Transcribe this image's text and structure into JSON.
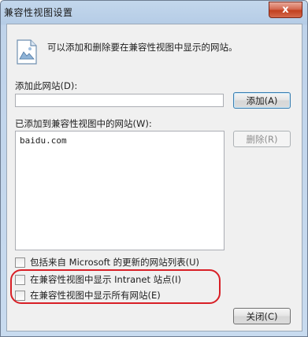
{
  "window": {
    "title": "兼容性视图设置",
    "close_glyph": "x"
  },
  "intro": {
    "text": "可以添加和删除要在兼容性视图中显示的网站。",
    "icon": "web-page-icon"
  },
  "add_site": {
    "label": "添加此网站(D):",
    "value": "",
    "button_label": "添加(A)"
  },
  "site_list": {
    "label": "已添加到兼容性视图中的网站(W):",
    "items": [
      "baidu.com"
    ],
    "remove_label": "删除(R)"
  },
  "options": [
    {
      "label": "包括来自 Microsoft 的更新的网站列表(U)",
      "checked": false
    },
    {
      "label": "在兼容性视图中显示 Intranet 站点(I)",
      "checked": false
    },
    {
      "label": "在兼容性视图中显示所有网站(E)",
      "checked": false
    }
  ],
  "close_button": {
    "label": "关闭(C)"
  },
  "colors": {
    "annotation": "#d81f26"
  }
}
